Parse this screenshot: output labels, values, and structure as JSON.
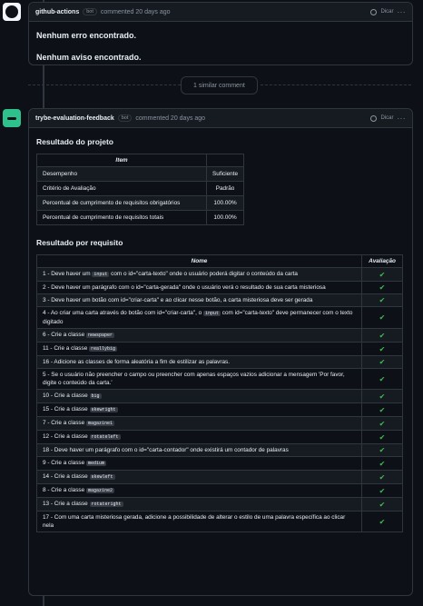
{
  "comment1": {
    "author": "github-actions",
    "badge": "bot",
    "meta": "commented 20 days ago",
    "reaction_label": "Dicar",
    "lines": [
      "Nenhum erro encontrado.",
      "Nenhum aviso encontrado."
    ]
  },
  "similar_label": "1 similar comment",
  "comment2": {
    "author": "trybe-evaluation-feedback",
    "badge": "bot",
    "meta": "commented 20 days ago",
    "reaction_label": "Dicar",
    "section1_title": "Resultado do projeto",
    "table1": {
      "header": "Item",
      "rows": [
        {
          "label": "Desempenho",
          "value": "Suficiente"
        },
        {
          "label": "Critério de Avaliação",
          "value": "Padrão"
        },
        {
          "label": "Percentual de cumprimento de requisitos obrigatórios",
          "value": "100.00%"
        },
        {
          "label": "Percentual de cumprimento de requisitos totais",
          "value": "100.00%"
        }
      ]
    },
    "section2_title": "Resultado por requisito",
    "table2": {
      "col_name": "Nome",
      "col_eval": "Avaliação",
      "check": "✔",
      "rows": [
        {
          "pre": "1 - Deve haver um",
          "code": "input",
          "post": "com o id=\"carta-texto\" onde o usuário poderá digitar o conteúdo da carta"
        },
        {
          "pre": "2 - Deve haver um parágrafo com o id=\"carta-gerada\" onde o usuário verá o resultado de sua carta misteriosa",
          "code": "",
          "post": ""
        },
        {
          "pre": "3 - Deve haver um botão com id=\"criar-carta\" e ao clicar nesse botão, a carta misteriosa deve ser gerada",
          "code": "",
          "post": ""
        },
        {
          "pre": "4 - Ao criar uma carta através do botão com id=\"criar-carta\", o",
          "code": "input",
          "post": "com id=\"carta-texto\" deve permanecer com o texto digitado"
        },
        {
          "pre": "6 - Crie a classe",
          "code": "newspaper",
          "post": ""
        },
        {
          "pre": "11 - Crie a classe",
          "code": "reallybig",
          "post": ""
        },
        {
          "pre": "16 - Adicione as classes de forma aleatória a fim de estilizar as palavras.",
          "code": "",
          "post": ""
        },
        {
          "pre": "5 - Se o usuário não preencher o campo ou preencher com apenas espaços vazios adicionar a mensagem 'Por favor, digite o conteúdo da carta.'",
          "code": "",
          "post": ""
        },
        {
          "pre": "10 - Crie a classe",
          "code": "big",
          "post": ""
        },
        {
          "pre": "15 - Crie a classe",
          "code": "skewright",
          "post": ""
        },
        {
          "pre": "7 - Crie a classe",
          "code": "magazine1",
          "post": ""
        },
        {
          "pre": "12 - Crie a classe",
          "code": "rotateleft",
          "post": ""
        },
        {
          "pre": "18 - Deve haver um parágrafo com o id=\"carta-contador\" onde existirá um contador de palavras",
          "code": "",
          "post": ""
        },
        {
          "pre": "9 - Crie a classe",
          "code": "medium",
          "post": ""
        },
        {
          "pre": "14 - Crie a classe",
          "code": "skewleft",
          "post": ""
        },
        {
          "pre": "8 - Crie a classe",
          "code": "magazine2",
          "post": ""
        },
        {
          "pre": "13 - Crie a classe",
          "code": "rotateright",
          "post": ""
        },
        {
          "pre": "17 - Com uma carta misteriosa gerada, adicione a possibilidade de alterar o estilo de uma palavra específica ao clicar nela",
          "code": "",
          "post": ""
        }
      ]
    }
  }
}
